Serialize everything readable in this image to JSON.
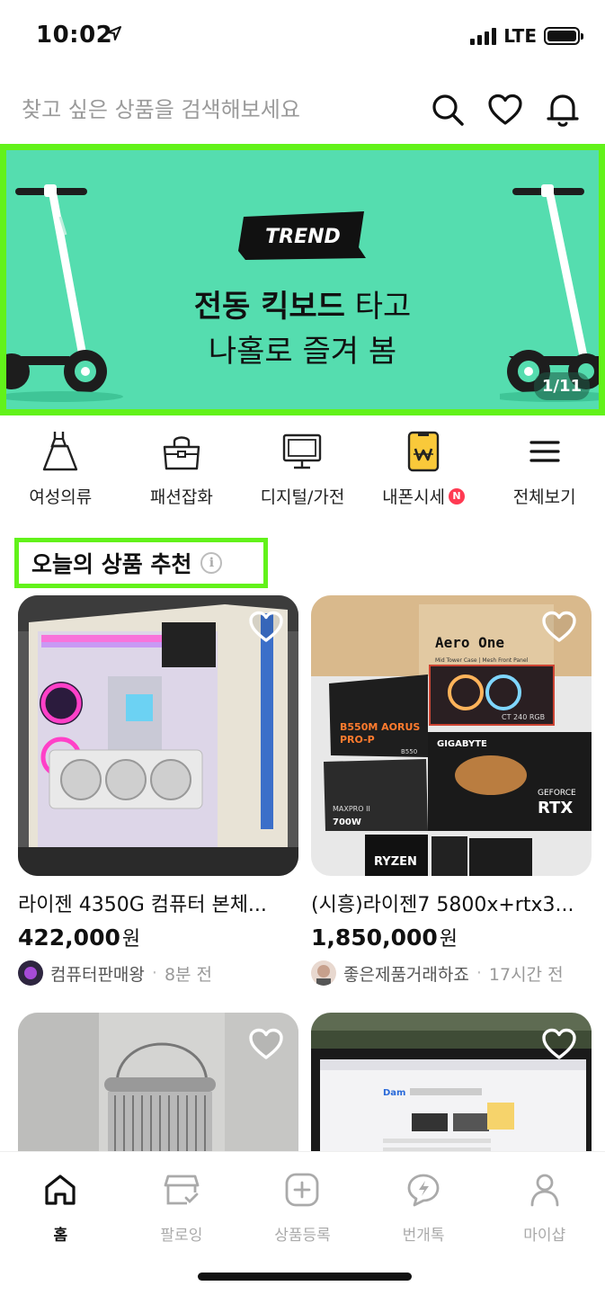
{
  "status_bar": {
    "time": "10:02",
    "network": "LTE"
  },
  "search": {
    "placeholder": "찾고 싶은 상품을 검색해보세요"
  },
  "header_icons": [
    "search-icon",
    "heart-icon",
    "bell-icon"
  ],
  "banner": {
    "badge": "TREND",
    "title_bold": "전동 킥보드",
    "title_rest": " 타고",
    "subtitle": "나홀로 즐겨 봄",
    "counter": "1/11",
    "background_color": "#55ddaf"
  },
  "categories": [
    {
      "label": "여성의류",
      "icon": "dress-icon"
    },
    {
      "label": "패션잡화",
      "icon": "handbag-icon"
    },
    {
      "label": "디지털/가전",
      "icon": "monitor-icon"
    },
    {
      "label": "내폰시세",
      "icon": "phone-price-icon",
      "badge": "N"
    },
    {
      "label": "전체보기",
      "icon": "menu-icon"
    }
  ],
  "section": {
    "title": "오늘의 상품 추천"
  },
  "products": [
    {
      "title": "라이젠 4350G 컴퓨터 본체...",
      "price": "422,000",
      "currency": "원",
      "seller": "컴퓨터판매왕",
      "time": "8분 전"
    },
    {
      "title": "(시흥)라이젠7 5800x+rtx3...",
      "price": "1,850,000",
      "currency": "원",
      "seller": "좋은제품거래하죠",
      "time": "17시간 전"
    },
    {
      "title": "",
      "price": "",
      "currency": "",
      "seller": "",
      "time": ""
    },
    {
      "title": "",
      "price": "",
      "currency": "",
      "seller": "",
      "time": ""
    }
  ],
  "product_images": {
    "p1": {
      "case_text": ""
    },
    "p2": {
      "box_label": "Aero One",
      "box_sub": "Mid Tower Case | Mesh Front Panel",
      "mb_label1": "B550M AORUS",
      "mb_label2": "PRO-P",
      "mb_label3": "B550",
      "cooler_label": "CT 240 RGB",
      "gpu_brand": "GIGABYTE",
      "gpu_label1": "GEFORCE",
      "gpu_label2": "RTX",
      "psu_label1": "MAXPRO II",
      "psu_label2": "700W",
      "cpu_label": "RYZEN"
    },
    "p4": {
      "site_logo": "Dam"
    }
  },
  "bottom_nav": [
    {
      "label": "홈",
      "icon": "home-icon",
      "active": true
    },
    {
      "label": "팔로잉",
      "icon": "store-check-icon",
      "active": false
    },
    {
      "label": "상품등록",
      "icon": "plus-square-icon",
      "active": false
    },
    {
      "label": "번개톡",
      "icon": "chat-bolt-icon",
      "active": false
    },
    {
      "label": "마이샵",
      "icon": "person-icon",
      "active": false
    }
  ],
  "colors": {
    "highlight_border": "#62f21a",
    "badge_red": "#ff3a52"
  }
}
